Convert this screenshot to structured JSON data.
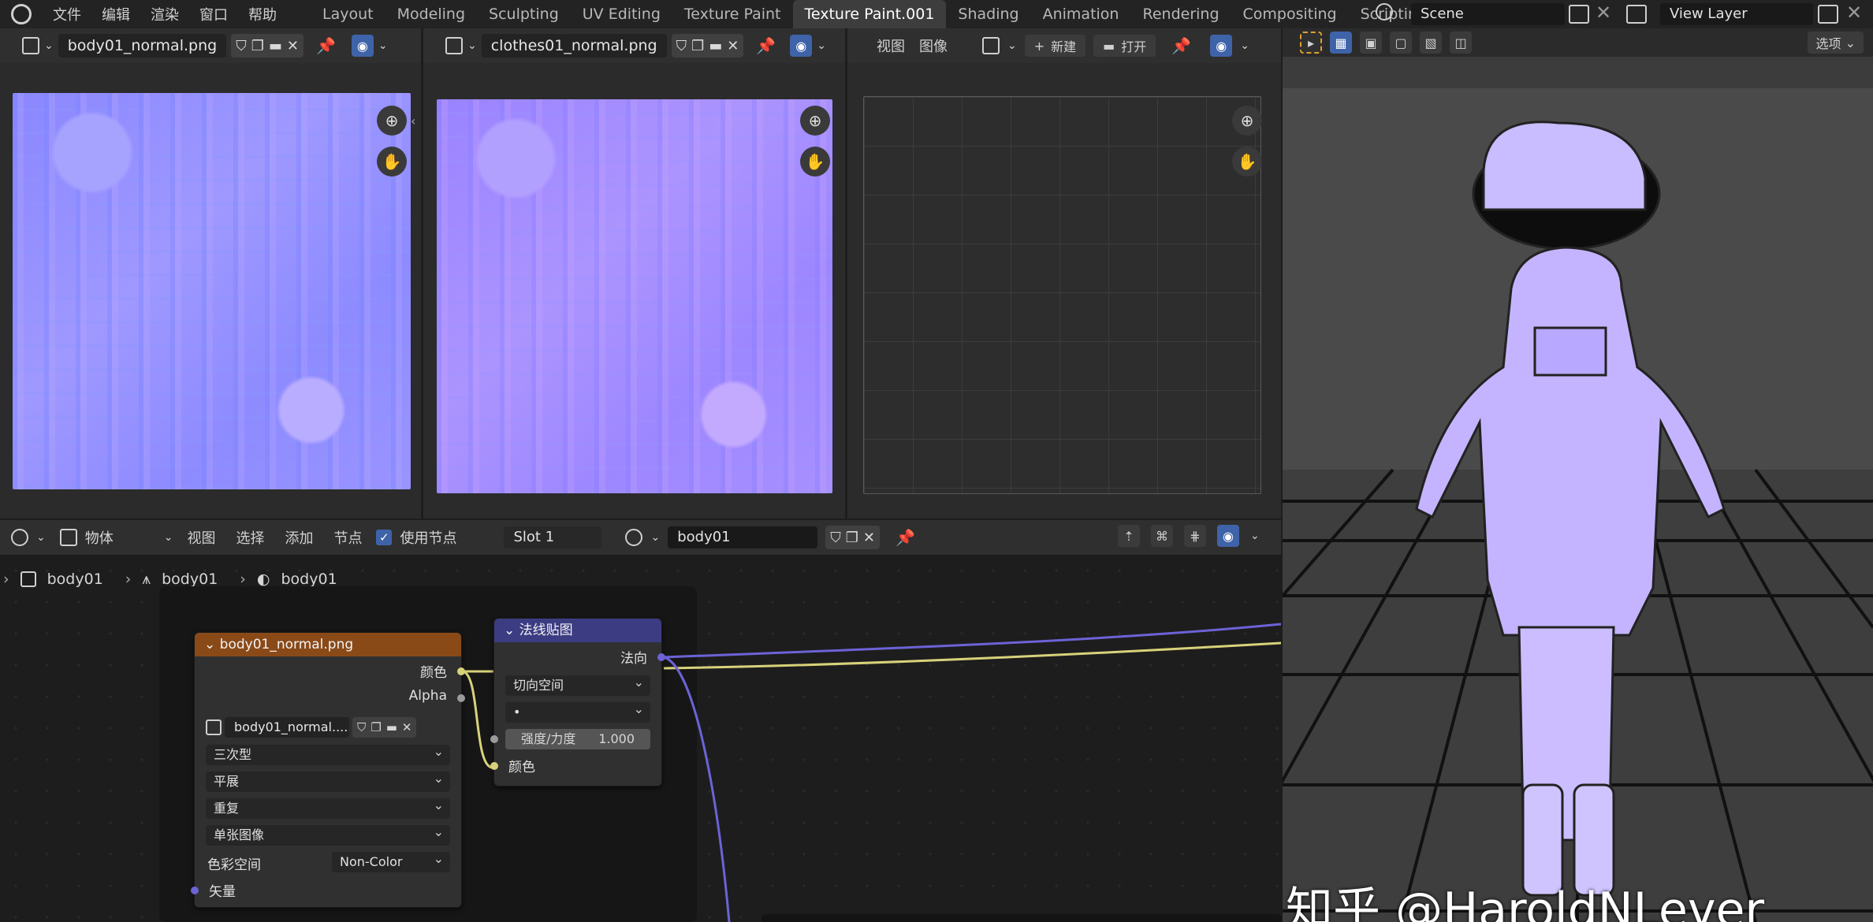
{
  "topbar": {
    "menus": [
      "文件",
      "编辑",
      "渲染",
      "窗口",
      "帮助"
    ],
    "workspaces": [
      "Layout",
      "Modeling",
      "Sculpting",
      "UV Editing",
      "Texture Paint",
      "Texture Paint.001",
      "Shading",
      "Animation",
      "Rendering",
      "Compositing",
      "Scripting"
    ],
    "add_tab": "+",
    "scene": "Scene",
    "view_layer": "View Layer"
  },
  "image_editors": [
    {
      "image": "body01_normal.png"
    },
    {
      "image": "clothes01_normal.png"
    },
    {
      "menus": [
        "视图",
        "图像"
      ],
      "new_label": "新建",
      "open_label": "打开"
    }
  ],
  "node_editor": {
    "object_mode": "物体",
    "menus": [
      "视图",
      "选择",
      "添加",
      "节点"
    ],
    "use_nodes_label": "使用节点",
    "slot": "Slot 1",
    "material": "body01",
    "breadcrumb": [
      "body01",
      "body01",
      "body01"
    ],
    "image_node": {
      "title": "body01_normal.png",
      "outputs": [
        "颜色",
        "Alpha"
      ],
      "image_field": "body01_normal....",
      "interpolation": "三次型",
      "projection": "平展",
      "extension": "重复",
      "source": "单张图像",
      "colorspace_label": "色彩空间",
      "colorspace_value": "Non-Color",
      "input": "矢量"
    },
    "normal_node": {
      "title": "法线贴图",
      "output": "法向",
      "space": "切向空间",
      "uv_value": "•",
      "strength_label": "强度/力度",
      "strength_value": "1.000",
      "input": "颜色"
    }
  },
  "viewport": {
    "options_label": "选项",
    "watermark": "知乎 @HaroldNLever"
  },
  "colors": {
    "image_node_header": "#8a4a18",
    "normal_node_header": "#3c3c83",
    "link_yellow": "#d8d27a",
    "link_purple": "#6c63d6"
  }
}
